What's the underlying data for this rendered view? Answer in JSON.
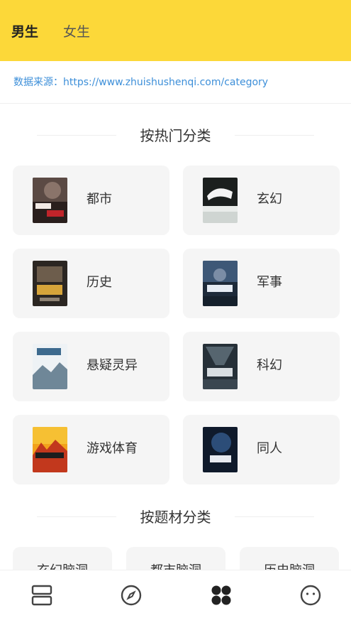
{
  "tabs": {
    "male": "男生",
    "female": "女生",
    "active": "male"
  },
  "source": {
    "label": "数据来源：",
    "url": "https://www.zhuishushenqi.com/category"
  },
  "sections": {
    "hot": "按热门分类",
    "theme": "按题材分类"
  },
  "hot_categories": [
    {
      "name": "都市"
    },
    {
      "name": "玄幻"
    },
    {
      "name": "历史"
    },
    {
      "name": "军事"
    },
    {
      "name": "悬疑灵异"
    },
    {
      "name": "科幻"
    },
    {
      "name": "游戏体育"
    },
    {
      "name": "同人"
    }
  ],
  "theme_categories": [
    {
      "name": "玄幻脑洞"
    },
    {
      "name": "都市脑洞"
    },
    {
      "name": "历史脑洞"
    }
  ],
  "bottom_nav": [
    {
      "icon": "bookshelf-icon"
    },
    {
      "icon": "compass-icon"
    },
    {
      "icon": "category-icon",
      "active": true
    },
    {
      "icon": "profile-icon"
    }
  ],
  "colors": {
    "accent": "#fcd839",
    "link": "#3d8fd9",
    "card_bg": "#f5f5f5"
  }
}
